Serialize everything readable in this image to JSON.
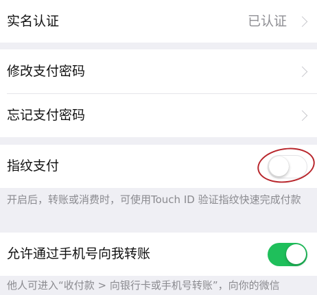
{
  "rows": {
    "real_name": {
      "label": "实名认证",
      "value": "已认证"
    },
    "change_password": {
      "label": "修改支付密码"
    },
    "forgot_password": {
      "label": "忘记支付密码"
    },
    "fingerprint": {
      "label": "指纹支付",
      "enabled": false
    },
    "phone_transfer": {
      "label": "允许通过手机号向我转账",
      "enabled": true
    }
  },
  "hints": {
    "fingerprint": "开启后，转账或消费时，可使用Touch ID 验证指纹快速完成付款",
    "phone_transfer": "他人可进入“收付款 > 向银行卡或手机号转账”，向你的微信"
  },
  "colors": {
    "toggle_on": "#1fbf5b",
    "annotation": "#b8262c",
    "background": "#efeff4"
  },
  "icons": {
    "chevron": "chevron-right-icon"
  }
}
